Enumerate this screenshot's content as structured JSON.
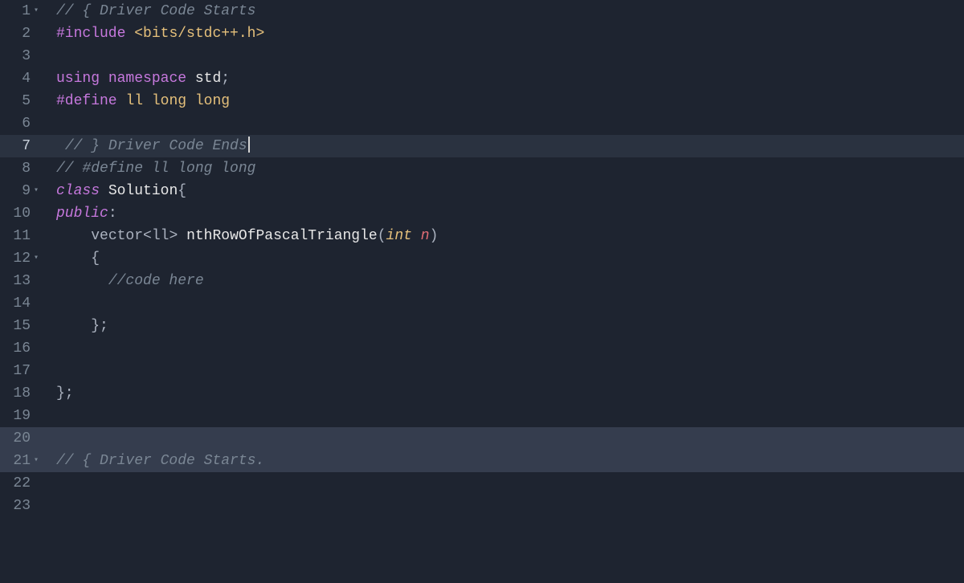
{
  "lines": [
    {
      "num": "1",
      "fold": true,
      "active": false,
      "hl": false,
      "tokens": [
        {
          "cls": "c-comment",
          "text": "// { Driver Code Starts"
        }
      ]
    },
    {
      "num": "2",
      "fold": false,
      "active": false,
      "hl": false,
      "tokens": [
        {
          "cls": "c-preproc",
          "text": "#include"
        },
        {
          "cls": "",
          "text": " "
        },
        {
          "cls": "c-preproc-arg",
          "text": "<bits/stdc++.h>"
        }
      ]
    },
    {
      "num": "3",
      "fold": false,
      "active": false,
      "hl": false,
      "tokens": []
    },
    {
      "num": "4",
      "fold": false,
      "active": false,
      "hl": false,
      "tokens": [
        {
          "cls": "c-keyword",
          "text": "using"
        },
        {
          "cls": "",
          "text": " "
        },
        {
          "cls": "c-keyword",
          "text": "namespace"
        },
        {
          "cls": "",
          "text": " "
        },
        {
          "cls": "c-white",
          "text": "std"
        },
        {
          "cls": "c-punct",
          "text": ";"
        }
      ]
    },
    {
      "num": "5",
      "fold": false,
      "active": false,
      "hl": false,
      "tokens": [
        {
          "cls": "c-preproc",
          "text": "#define"
        },
        {
          "cls": "",
          "text": " "
        },
        {
          "cls": "c-preproc-arg",
          "text": "ll long long"
        }
      ]
    },
    {
      "num": "6",
      "fold": false,
      "active": false,
      "hl": false,
      "tokens": []
    },
    {
      "num": "7",
      "fold": false,
      "active": true,
      "hl": false,
      "tokens": [
        {
          "cls": "",
          "text": " "
        },
        {
          "cls": "c-comment",
          "text": "// } Driver Code Ends"
        }
      ],
      "cursor": true
    },
    {
      "num": "8",
      "fold": false,
      "active": false,
      "hl": false,
      "tokens": [
        {
          "cls": "c-comment",
          "text": "// #define ll long long"
        }
      ]
    },
    {
      "num": "9",
      "fold": true,
      "active": false,
      "hl": false,
      "tokens": [
        {
          "cls": "c-keyword-it",
          "text": "class"
        },
        {
          "cls": "",
          "text": " "
        },
        {
          "cls": "c-white",
          "text": "Solution"
        },
        {
          "cls": "c-punct",
          "text": "{"
        }
      ]
    },
    {
      "num": "10",
      "fold": false,
      "active": false,
      "hl": false,
      "tokens": [
        {
          "cls": "c-keyword-it",
          "text": "public"
        },
        {
          "cls": "c-punct",
          "text": ":"
        }
      ]
    },
    {
      "num": "11",
      "fold": false,
      "active": false,
      "hl": false,
      "tokens": [
        {
          "cls": "",
          "text": "    "
        },
        {
          "cls": "c-ident",
          "text": "vector"
        },
        {
          "cls": "c-punct",
          "text": "<"
        },
        {
          "cls": "c-ident",
          "text": "ll"
        },
        {
          "cls": "c-punct",
          "text": ">"
        },
        {
          "cls": "",
          "text": " "
        },
        {
          "cls": "c-white",
          "text": "nthRowOfPascalTriangle"
        },
        {
          "cls": "c-punct",
          "text": "("
        },
        {
          "cls": "c-type-it",
          "text": "int"
        },
        {
          "cls": "",
          "text": " "
        },
        {
          "cls": "c-param",
          "text": "n"
        },
        {
          "cls": "c-punct",
          "text": ")"
        }
      ]
    },
    {
      "num": "12",
      "fold": true,
      "active": false,
      "hl": false,
      "tokens": [
        {
          "cls": "",
          "text": "    "
        },
        {
          "cls": "c-punct",
          "text": "{"
        }
      ]
    },
    {
      "num": "13",
      "fold": false,
      "active": false,
      "hl": false,
      "tokens": [
        {
          "cls": "",
          "text": "      "
        },
        {
          "cls": "c-comment",
          "text": "//code here"
        }
      ]
    },
    {
      "num": "14",
      "fold": false,
      "active": false,
      "hl": false,
      "tokens": []
    },
    {
      "num": "15",
      "fold": false,
      "active": false,
      "hl": false,
      "tokens": [
        {
          "cls": "",
          "text": "    "
        },
        {
          "cls": "c-punct",
          "text": "};"
        }
      ]
    },
    {
      "num": "16",
      "fold": false,
      "active": false,
      "hl": false,
      "tokens": []
    },
    {
      "num": "17",
      "fold": false,
      "active": false,
      "hl": false,
      "tokens": []
    },
    {
      "num": "18",
      "fold": false,
      "active": false,
      "hl": false,
      "tokens": [
        {
          "cls": "c-punct",
          "text": "};"
        }
      ]
    },
    {
      "num": "19",
      "fold": false,
      "active": false,
      "hl": false,
      "tokens": []
    },
    {
      "num": "20",
      "fold": false,
      "active": false,
      "hl": true,
      "tokens": []
    },
    {
      "num": "21",
      "fold": true,
      "active": false,
      "hl": true,
      "tokens": [
        {
          "cls": "c-comment",
          "text": "// { Driver Code Starts."
        }
      ]
    },
    {
      "num": "22",
      "fold": false,
      "active": false,
      "hl": false,
      "tokens": []
    },
    {
      "num": "23",
      "fold": false,
      "active": false,
      "hl": false,
      "tokens": []
    }
  ]
}
